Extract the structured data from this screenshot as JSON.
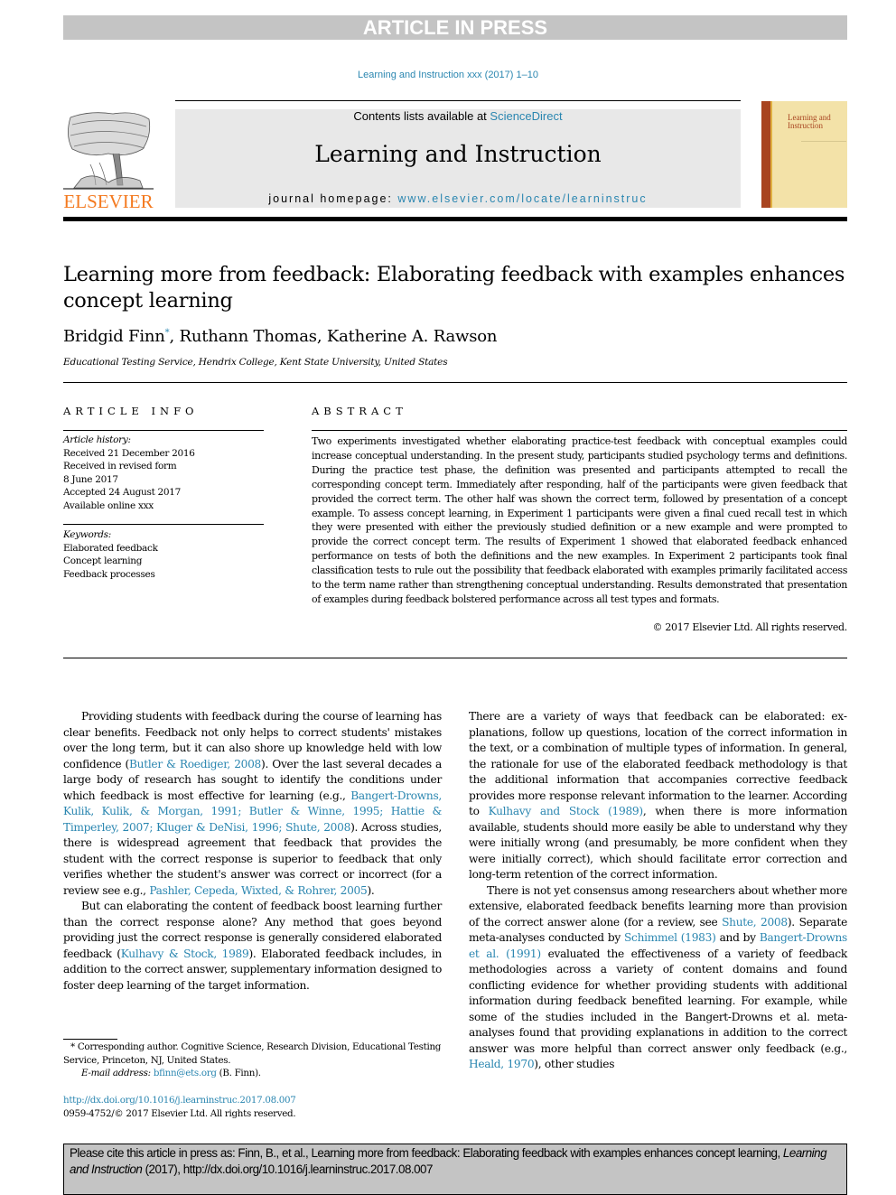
{
  "banner": "ARTICLE IN PRESS",
  "journal_ref": "Learning and Instruction xxx (2017) 1–10",
  "masthead": {
    "contents_prefix": "Contents lists available at ",
    "contents_link": "ScienceDirect",
    "journal_title": "Learning and Instruction",
    "homepage_prefix": "journal homepage: ",
    "homepage_link": "www.elsevier.com/locate/learninstruc",
    "publisher": "ELSEVIER",
    "cover_title_line1": "Learning and",
    "cover_title_line2": "Instruction"
  },
  "article": {
    "title": "Learning more from feedback: Elaborating feedback with examples enhances concept learning",
    "authors": [
      {
        "name": "Bridgid Finn",
        "mark": "*"
      },
      {
        "name": "Ruthann Thomas"
      },
      {
        "name": "Katherine A. Rawson"
      }
    ],
    "author_sep": ", ",
    "affiliation": "Educational Testing Service, Hendrix College, Kent State University, United States"
  },
  "article_info": {
    "heading": "ARTICLE INFO",
    "history_label": "Article history:",
    "history": [
      "Received 21 December 2016",
      "Received in revised form",
      "8 June 2017",
      "Accepted 24 August 2017",
      "Available online xxx"
    ],
    "keywords_label": "Keywords:",
    "keywords": [
      "Elaborated feedback",
      "Concept learning",
      "Feedback processes"
    ]
  },
  "abstract": {
    "heading": "ABSTRACT",
    "text": "Two experiments investigated whether elaborating practice-test feedback with conceptual examples could increase conceptual understanding. In the present study, participants studied psychology terms and definitions. During the practice test phase, the definition was presented and participants attempted to recall the corresponding concept term. Immediately after responding, half of the participants were given feedback that provided the correct term. The other half was shown the correct term, followed by presentation of a concept example. To assess concept learning, in Experiment 1 participants were given a final cued recall test in which they were presented with either the previously studied definition or a new example and were prompted to provide the correct concept term. The results of Experiment 1 showed that elaborated feedback enhanced performance on tests of both the definitions and the new examples. In Experiment 2 participants took final classification tests to rule out the possibility that feedback elaborated with examples primarily facilitated access to the term name rather than strengthening conceptual understanding. Results demonstrated that presentation of examples during feedback bolstered performance across all test types and formats.",
    "copyright": "© 2017 Elsevier Ltd. All rights reserved."
  },
  "body": {
    "left": [
      [
        {
          "t": "Providing students with feedback during the course of learning has clear benefits. Feedback not only helps to correct students' mistakes over the long term, but it can also shore up knowledge held with low confidence ("
        },
        {
          "t": "Butler & Roediger, 2008",
          "link": true
        },
        {
          "t": "). Over the last several decades a large body of research has sought to identify the conditions under which feedback is most effective for learning (e.g., "
        },
        {
          "t": "Bangert-Drowns, Kulik, Kulik, & Morgan, 1991; Butler & Winne, 1995; Hattie & Timperley, 2007; Kluger & DeNisi, 1996; Shute, 2008",
          "link": true
        },
        {
          "t": "). Across studies, there is widespread agreement that feed­back that provides the student with the correct response is superior to feedback that only verifies whether the student's answer was correct or incorrect (for a review see e.g., "
        },
        {
          "t": "Pashler, Cepeda, Wixted, & Rohrer, 2005",
          "link": true
        },
        {
          "t": ")."
        }
      ],
      [
        {
          "t": "But can elaborating the content of feedback boost learning further than the correct response alone? Any method that goes beyond providing just the correct response is generally considered elaborated feedback ("
        },
        {
          "t": "Kulhavy & Stock, 1989",
          "link": true
        },
        {
          "t": "). Elaborated feedback includes, in addition to the correct answer, supplementary infor­mation designed to foster deep learning of the target information."
        }
      ]
    ],
    "right": [
      [
        {
          "t": "There are a variety of ways that feedback can be elaborated: ex­planations, follow up questions, location of the correct information in the text, or a combination of multiple types of information. In general, the rationale for use of the elaborated feedback method­ology is that the additional information that accompanies correc­tive feedback provides more response relevant information to the learner. According to "
        },
        {
          "t": "Kulhavy and Stock (1989)",
          "link": true
        },
        {
          "t": ", when there is more information available, students should more easily be able to un­derstand why they were initially wrong (and presumably, be more confident when they were initially correct), which should facilitate error correction and long-term retention of the correct information."
        }
      ],
      [
        {
          "t": "There is not yet consensus among researchers about whether more extensive, elaborated feedback benefits learning more than provision of the correct answer alone (for a review, see "
        },
        {
          "t": "Shute, 2008",
          "link": true
        },
        {
          "t": "). Separate meta-analyses conducted by "
        },
        {
          "t": "Schimmel (1983)",
          "link": true
        },
        {
          "t": " and by "
        },
        {
          "t": "Bangert-Drowns et al. (1991)",
          "link": true
        },
        {
          "t": " evaluated the effectiveness of a variety of feedback methodologies across a variety of content domains and found conflicting evidence for whether providing students with additional information during feedback benefited learning. For example, while some of the studies included in the Bangert-Drowns et al. meta-analyses found that providing expla­nations in addition to the correct answer was more helpful than correct answer only feedback (e.g., "
        },
        {
          "t": "Heald, 1970",
          "link": true
        },
        {
          "t": "), other studies"
        }
      ]
    ]
  },
  "footnote": {
    "mark": "*",
    "text": "Corresponding author. Cognitive Science, Research Division, Educational Testing Service, Princeton, NJ, United States.",
    "email_label": "E-mail address:",
    "email": "bfinn@ets.org",
    "email_suffix": " (B. Finn)."
  },
  "doi": {
    "link": "http://dx.doi.org/10.1016/j.learninstruc.2017.08.007",
    "issn_copyright": "0959-4752/© 2017 Elsevier Ltd. All rights reserved."
  },
  "citation_box": {
    "prefix": "Please cite this article in press as: Finn, B., et al., Learning more from feedback: Elaborating feedback with examples enhances concept learning, ",
    "journal": "Learning and Instruction",
    "suffix": " (2017), http://dx.doi.org/10.1016/j.learninstruc.2017.08.007"
  }
}
